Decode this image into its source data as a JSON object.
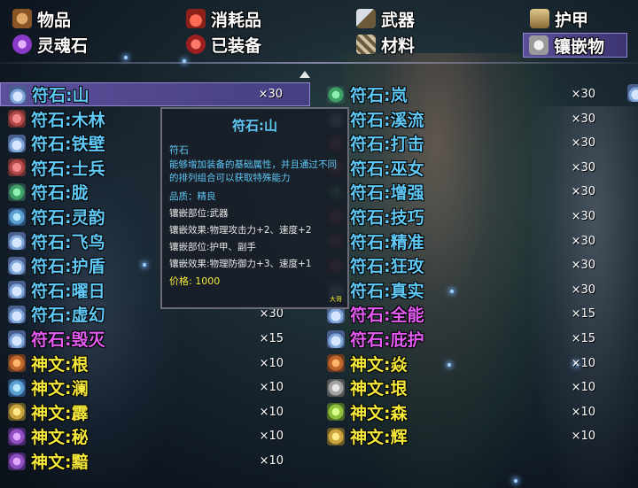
{
  "tabs": [
    {
      "label": "物品",
      "icon": "bag-icon",
      "color": "#b5793a",
      "selected": false
    },
    {
      "label": "消耗品",
      "icon": "potion-icon",
      "color": "#c73b2e",
      "selected": false
    },
    {
      "label": "武器",
      "icon": "sword-icon",
      "color": "#9aa3ad",
      "selected": false
    },
    {
      "label": "护甲",
      "icon": "armor-icon",
      "color": "#c9b07a",
      "selected": false
    },
    {
      "label": "灵魂石",
      "icon": "soul-stone-icon",
      "color": "#9a4fd0",
      "selected": false
    },
    {
      "label": "已装备",
      "icon": "equipped-icon",
      "color": "#d43a3a",
      "selected": false
    },
    {
      "label": "材料",
      "icon": "material-icon",
      "color": "#a08a6a",
      "selected": false
    },
    {
      "label": "镶嵌物",
      "icon": "inlay-icon",
      "color": "#c8c8c8",
      "selected": true
    }
  ],
  "left_items": [
    {
      "name": "符石:山",
      "count": "×30",
      "color": "blue",
      "icon": "ic-tri",
      "selected": true
    },
    {
      "name": "符石:木林",
      "count": "",
      "color": "blue",
      "icon": "ic-red"
    },
    {
      "name": "符石:铁壁",
      "count": "",
      "color": "blue",
      "icon": "ic-tri"
    },
    {
      "name": "符石:士兵",
      "count": "",
      "color": "blue",
      "icon": "ic-red"
    },
    {
      "name": "符石:胧",
      "count": "",
      "color": "blue",
      "icon": "ic-green"
    },
    {
      "name": "符石:灵韵",
      "count": "",
      "color": "blue",
      "icon": "ic-cross"
    },
    {
      "name": "符石:飞鸟",
      "count": "",
      "color": "blue",
      "icon": "ic-tri"
    },
    {
      "name": "符石:护盾",
      "count": "",
      "color": "blue",
      "icon": "ic-tri"
    },
    {
      "name": "符石:曜日",
      "count": "",
      "color": "blue",
      "icon": "ic-tri"
    },
    {
      "name": "符石:虚幻",
      "count": "×30",
      "color": "blue",
      "icon": "ic-tri"
    },
    {
      "name": "符石:毁灭",
      "count": "×15",
      "color": "magenta",
      "icon": "ic-tri"
    },
    {
      "name": "神文:根",
      "count": "×10",
      "color": "yellow",
      "icon": "ic-orange"
    },
    {
      "name": "神文:澜",
      "count": "×10",
      "color": "yellow",
      "icon": "ic-cross"
    },
    {
      "name": "神文:霹",
      "count": "×10",
      "color": "yellow",
      "icon": "ic-gold"
    },
    {
      "name": "神文:秘",
      "count": "×10",
      "color": "yellow",
      "icon": "ic-purple"
    },
    {
      "name": "神文:黯",
      "count": "×10",
      "color": "yellow",
      "icon": "ic-purple"
    }
  ],
  "right_items": [
    {
      "name": "符石:岚",
      "count": "×30",
      "color": "blue",
      "icon": "ic-green"
    },
    {
      "name": "符石:溪流",
      "count": "×30",
      "color": "blue",
      "icon": "ic-tri"
    },
    {
      "name": "符石:打击",
      "count": "×30",
      "color": "blue",
      "icon": "ic-red"
    },
    {
      "name": "符石:巫女",
      "count": "×30",
      "color": "blue",
      "icon": "ic-red"
    },
    {
      "name": "符石:增强",
      "count": "×30",
      "color": "blue",
      "icon": "ic-green"
    },
    {
      "name": "符石:技巧",
      "count": "×30",
      "color": "blue",
      "icon": "ic-red"
    },
    {
      "name": "符石:精准",
      "count": "×30",
      "color": "blue",
      "icon": "ic-red"
    },
    {
      "name": "符石:狂攻",
      "count": "×30",
      "color": "blue",
      "icon": "ic-red"
    },
    {
      "name": "符石:真实",
      "count": "×30",
      "color": "blue",
      "icon": "ic-tri"
    },
    {
      "name": "符石:全能",
      "count": "×15",
      "color": "magenta",
      "icon": "ic-tri"
    },
    {
      "name": "符石:庇护",
      "count": "×15",
      "color": "magenta",
      "icon": "ic-tri"
    },
    {
      "name": "神文:焱",
      "count": "×10",
      "color": "yellow",
      "icon": "ic-orange"
    },
    {
      "name": "神文:垠",
      "count": "×10",
      "color": "yellow",
      "icon": "ic-grey"
    },
    {
      "name": "神文:森",
      "count": "×10",
      "color": "yellow",
      "icon": "ic-lime"
    },
    {
      "name": "神文:辉",
      "count": "×10",
      "color": "yellow",
      "icon": "ic-gold"
    }
  ],
  "tooltip": {
    "title": "符石:山",
    "category": "符石",
    "description": "能够增加装备的基础属性，并且通过不同的排列组合可以获取特殊能力",
    "quality_label": "品质：",
    "quality_value": "精良",
    "slot": "镶嵌部位:武器",
    "effect1": "镶嵌效果:物理攻击力+2、速度+2",
    "slot2": "镶嵌部位:护甲、副手",
    "effect2": "镶嵌效果:物理防御力+3、速度+1",
    "price_label": "价格:",
    "price_value": "1000",
    "stamp": "大哥"
  },
  "colors": {
    "blue": "#5fc8f5",
    "magenta": "#e45bf2",
    "yellow": "#f5e83a",
    "selected_row": "#5b4f9a"
  }
}
